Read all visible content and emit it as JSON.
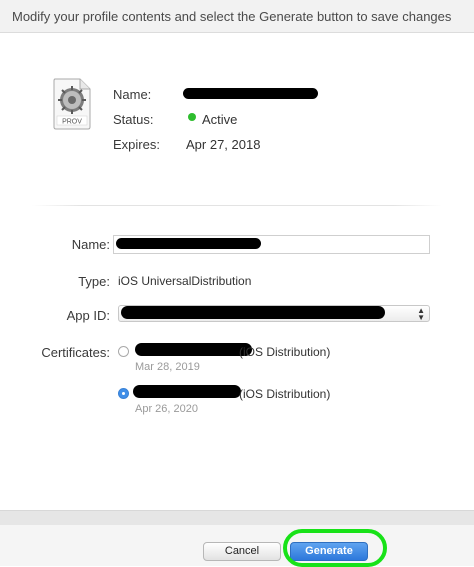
{
  "header": {
    "instruction": "Modify your profile contents and select the Generate button to save changes"
  },
  "profile_summary": {
    "icon": "provisioning-profile-icon",
    "icon_text": "PROV",
    "name_label": "Name:",
    "status_label": "Status:",
    "status_value": "Active",
    "status_color": "#2ebd2e",
    "expires_label": "Expires:",
    "expires_value": "Apr 27, 2018"
  },
  "form": {
    "name_label": "Name:",
    "type_label": "Type:",
    "type_value": "iOS UniversalDistribution",
    "app_id_label": "App ID:",
    "certificates_label": "Certificates:",
    "certificates": [
      {
        "suffix": "(iOS Distribution)",
        "date": "Mar 28, 2019",
        "selected": false
      },
      {
        "suffix": "(iOS Distribution)",
        "date": "Apr 26, 2020",
        "selected": true
      }
    ]
  },
  "footer": {
    "cancel_label": "Cancel",
    "generate_label": "Generate",
    "accent_color": "#2d78db",
    "highlight_color": "#18e218"
  }
}
